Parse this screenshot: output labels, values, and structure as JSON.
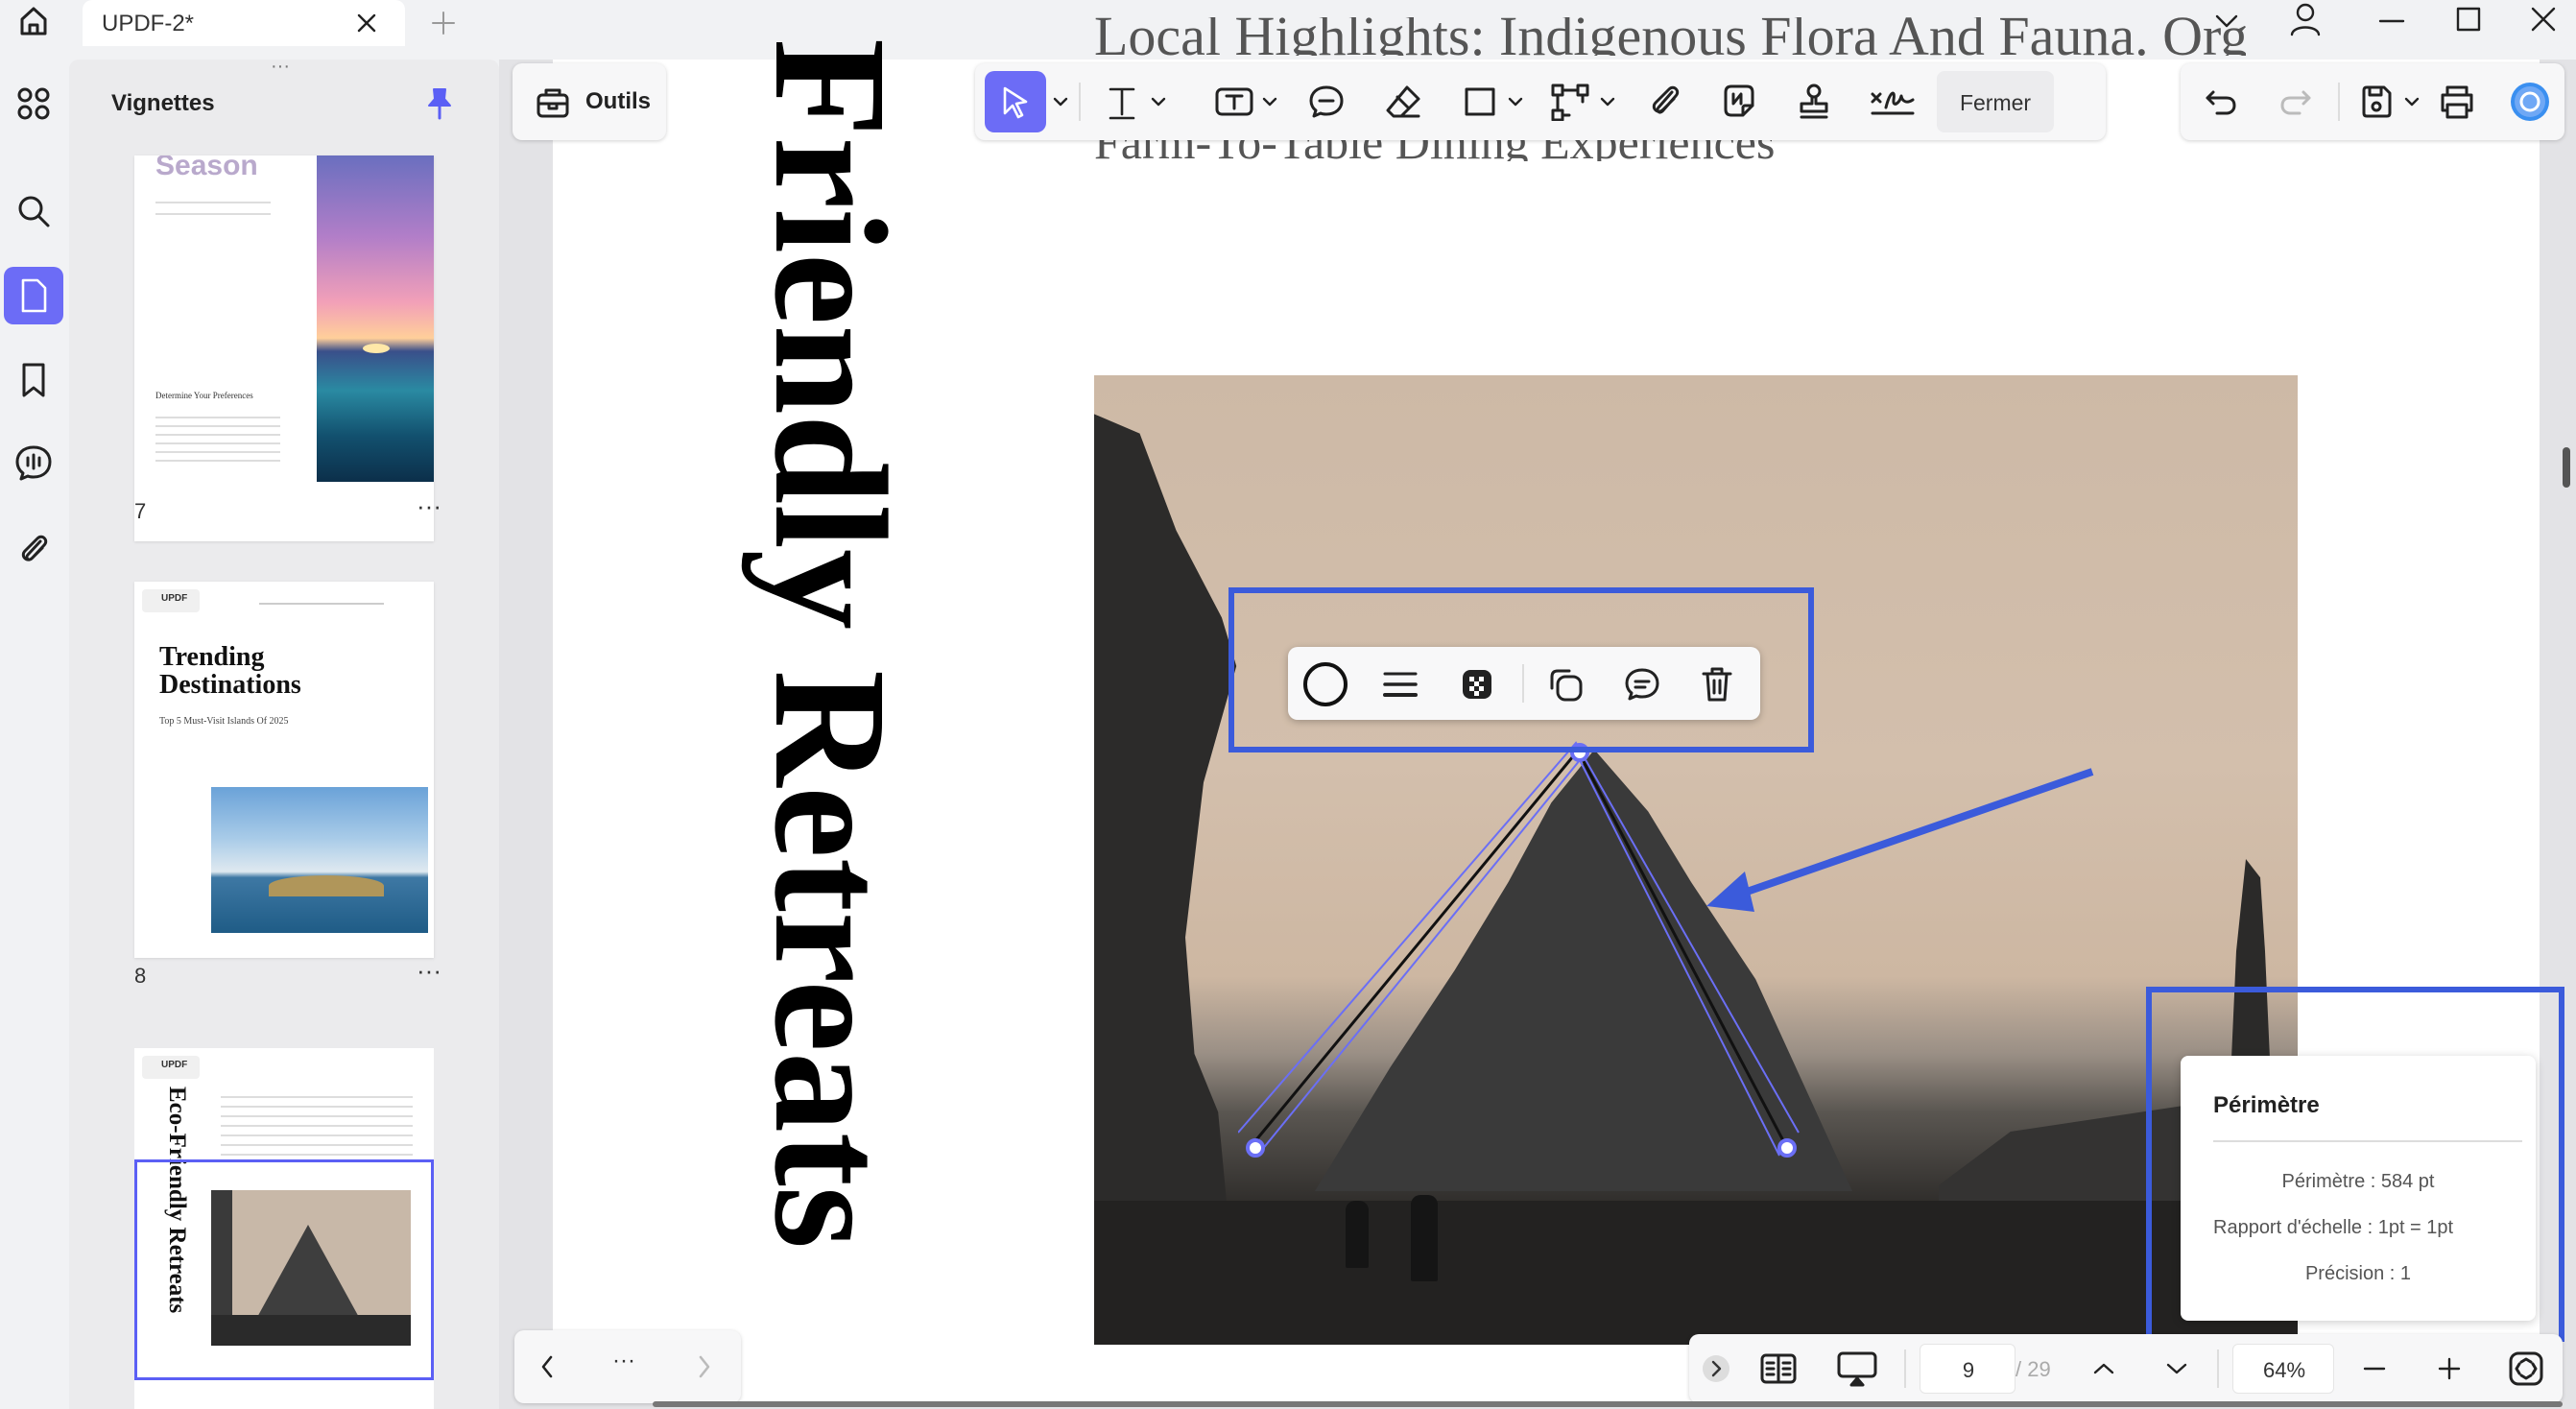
{
  "tab": {
    "title": "UPDF-2*"
  },
  "sidebar": {
    "title": "Vignettes"
  },
  "thumbnails": [
    {
      "page": "7",
      "title": "Season",
      "subtitle": "Determine Your Preferences",
      "more": "···"
    },
    {
      "page": "8",
      "title": "Trending Destinations",
      "subtitle": "Top 5 Must-Visit Islands Of 2025",
      "logo": "UPDF",
      "more": "···"
    },
    {
      "page": "",
      "title": "Eco-Friendly Retreats",
      "logo": "UPDF"
    }
  ],
  "toolbar": {
    "outils": "Outils",
    "fermer": "Fermer"
  },
  "document": {
    "heading_top": "Local Highlights: Indigenous Flora And Fauna. Organic",
    "heading_bottom": "Farm-To-Table Dining Experiences",
    "vertical_title": "Friendly Retreats"
  },
  "measure": {
    "title": "Périmètre",
    "perimeter": "Périmètre : 584 pt",
    "scale": "Rapport d'échelle : 1pt = 1pt",
    "precision": "Précision : 1"
  },
  "nav": {
    "current_page": "9",
    "total_pages": "/ 29",
    "zoom": "64%",
    "more": "···"
  },
  "colors": {
    "accent": "#5b5ff5",
    "highlight_box": "#3b5bdb",
    "active": "#6c6cf6"
  }
}
